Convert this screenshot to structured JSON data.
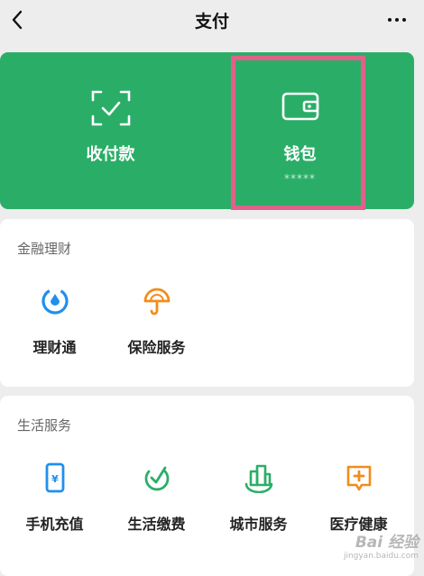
{
  "header": {
    "title": "支付"
  },
  "top_card": {
    "collect": {
      "label": "收付款"
    },
    "wallet": {
      "label": "钱包",
      "balance_masked": "*****"
    }
  },
  "finance": {
    "title": "金融理财",
    "items": [
      {
        "label": "理财通",
        "icon": "licaitong-icon"
      },
      {
        "label": "保险服务",
        "icon": "insurance-icon"
      }
    ]
  },
  "life": {
    "title": "生活服务",
    "items": [
      {
        "label": "手机充值",
        "icon": "phone-recharge-icon"
      },
      {
        "label": "生活缴费",
        "icon": "utility-payment-icon"
      },
      {
        "label": "城市服务",
        "icon": "city-service-icon"
      },
      {
        "label": "医疗健康",
        "icon": "medical-health-icon"
      }
    ]
  },
  "watermark": {
    "main": "Bai 经验",
    "sub": "jingyan.baidu.com"
  },
  "colors": {
    "green": "#2aae67",
    "highlight": "#e0618a",
    "blue": "#1f8ff0",
    "orange": "#f28c1b"
  }
}
